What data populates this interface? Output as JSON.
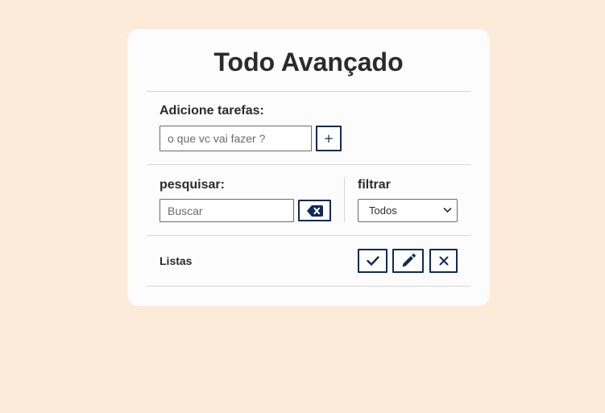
{
  "app": {
    "title": "Todo Avançado"
  },
  "add_section": {
    "label": "Adicione tarefas:",
    "input_placeholder": "o que vc vai fazer ?",
    "input_value": "",
    "add_button_label": "+"
  },
  "search_section": {
    "label": "pesquisar:",
    "input_placeholder": "Buscar",
    "input_value": "",
    "clear_icon": "backspace-icon"
  },
  "filter_section": {
    "label": "filtrar",
    "selected": "Todos"
  },
  "list_section": {
    "label": "Listas",
    "actions": [
      {
        "name": "done",
        "icon": "check-icon"
      },
      {
        "name": "edit",
        "icon": "pencil-icon"
      },
      {
        "name": "remove",
        "icon": "close-icon"
      }
    ]
  },
  "colors": {
    "page_background": "#fbebd8",
    "card_background": "#fcfcfc",
    "accent": "#102a54",
    "text": "#2b2b2b"
  }
}
